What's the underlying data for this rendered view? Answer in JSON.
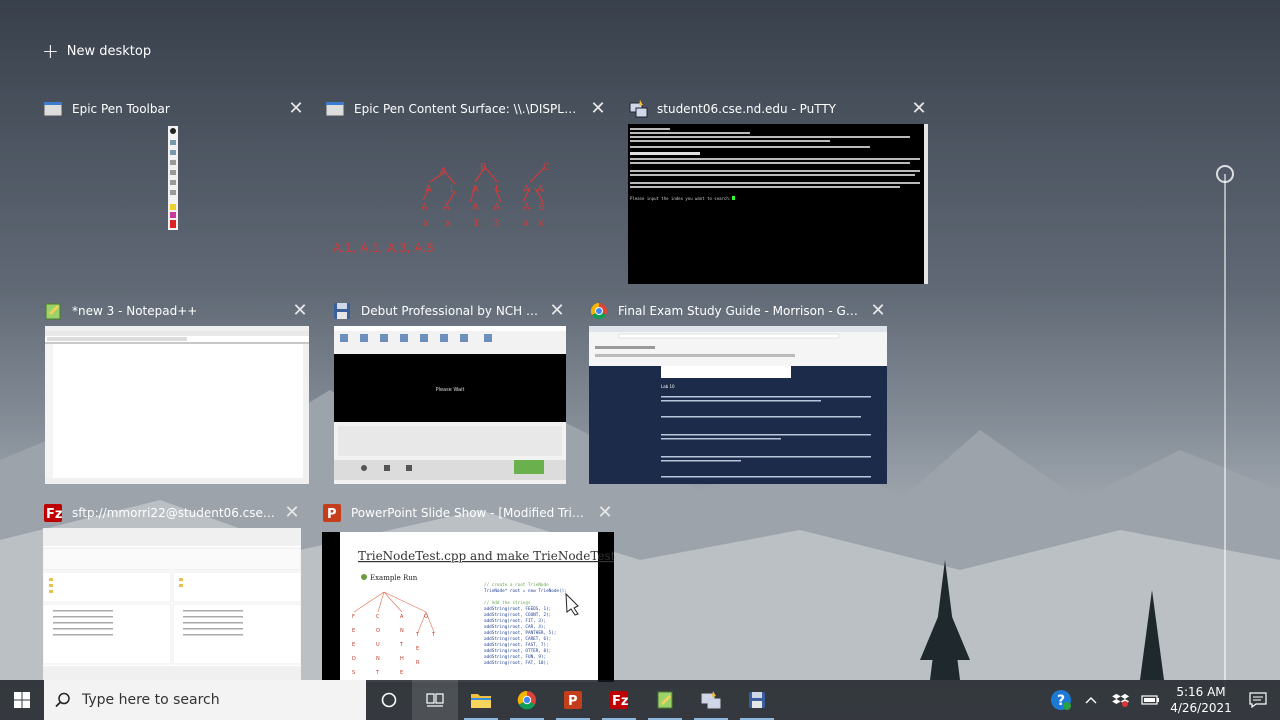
{
  "new_desktop_label": "New desktop",
  "windows": [
    {
      "title": "Epic Pen Toolbar",
      "icon": "epic-pen-icon"
    },
    {
      "title": "Epic Pen Content Surface: \\\\.\\DISPLAY1",
      "icon": "epic-pen-icon"
    },
    {
      "title": "student06.cse.nd.edu - PuTTY",
      "icon": "putty-icon"
    },
    {
      "title": "*new 3 - Notepad++",
      "icon": "notepad-plus-plus-icon"
    },
    {
      "title": "Debut Professional by NCH Soft...",
      "icon": "debut-icon"
    },
    {
      "title": "Final Exam Study Guide - Morrison - Google...",
      "icon": "chrome-icon"
    },
    {
      "title": "sftp://mmorri22@student06.cse.nd.e...",
      "icon": "filezilla-icon"
    },
    {
      "title": "PowerPoint Slide Show - [Modified Trie Slide...",
      "icon": "powerpoint-icon"
    }
  ],
  "thumbnails": {
    "epic_pen_text": "A.1, A.1, A.3, A.8",
    "putty_bottom": "Please input the index you want to search:",
    "debut_record_text": "Please Wait",
    "chrome_lab": "Lab 10",
    "ppt_slide_title": "TrieNodeTest.cpp and make TrieNodeTest",
    "ppt_bullet": "Example Run",
    "ppt_code": [
      "// create a root TrieNode",
      "TrieNode* root = new TrieNode();",
      "",
      "// Add the strings",
      "addString(root, FEEDS, 1);",
      "addString(root, COUNT, 2);",
      "addString(root, FIT, 3);",
      "addString(root, CAR, 4);",
      "addString(root, PANTHER, 5);",
      "addString(root, CARET, 6);",
      "addString(root, FAST, 7);",
      "addString(root, OTTER, 8);",
      "addString(root, FUN, 9);",
      "addString(root, FAT, 10);"
    ]
  },
  "taskbar": {
    "search_placeholder": "Type here to search",
    "time": "5:16 AM",
    "date": "4/26/2021"
  },
  "colors": {
    "taskbar_bg": "#14181e",
    "ppt_red": "#c43e1c",
    "filezilla_red": "#bf0000",
    "chrome_dark": "#1c2b49"
  }
}
